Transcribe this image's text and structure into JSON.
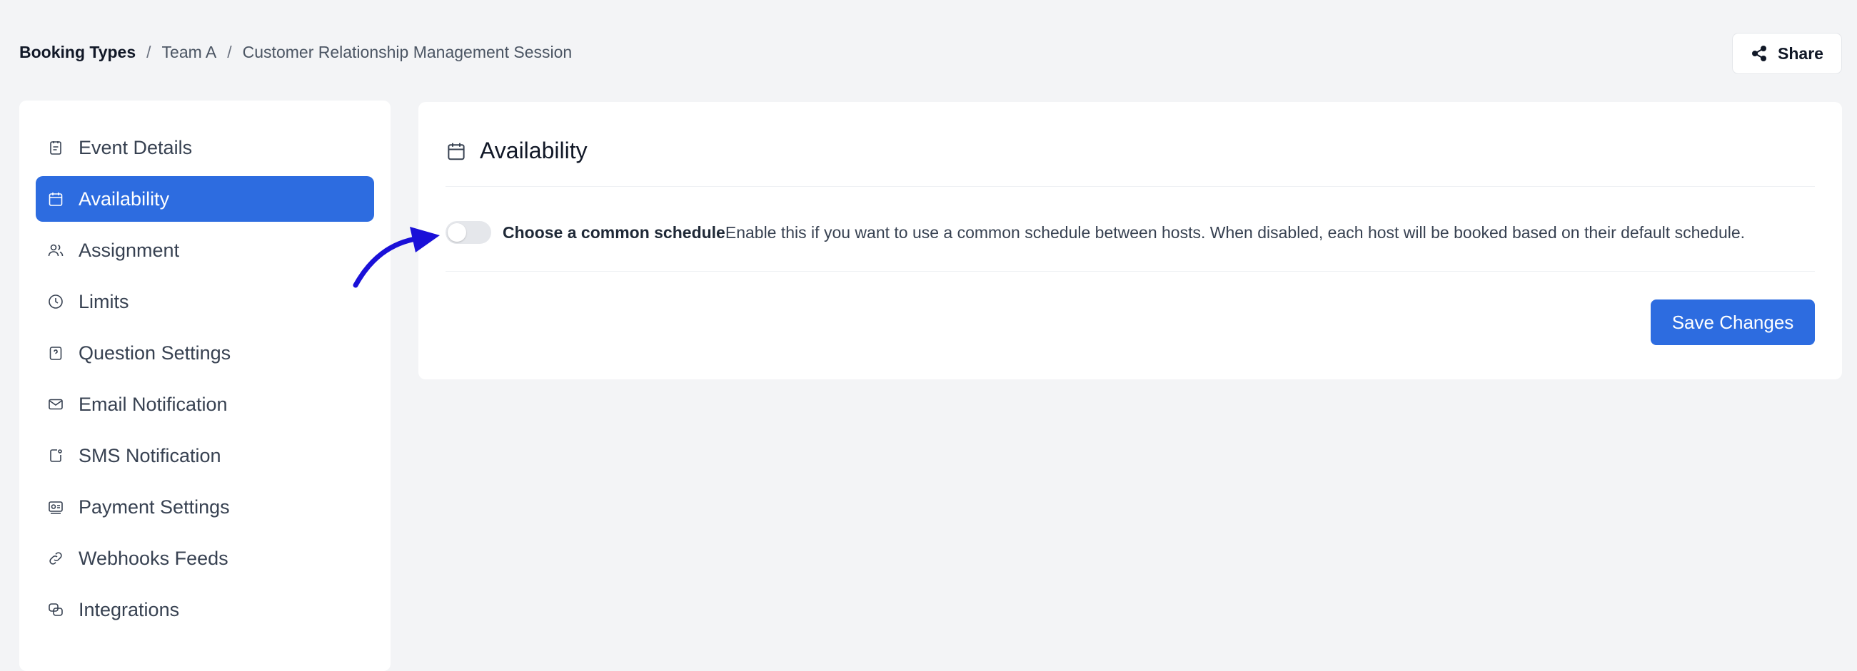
{
  "breadcrumb": {
    "root": "Booking Types",
    "team": "Team A",
    "current": "Customer Relationship Management Session",
    "separator": "/"
  },
  "header": {
    "share_label": "Share",
    "share_icon": "share-icon"
  },
  "sidebar": {
    "items": [
      {
        "label": "Event Details",
        "icon": "document-icon"
      },
      {
        "label": "Availability",
        "icon": "calendar-icon",
        "active": true
      },
      {
        "label": "Assignment",
        "icon": "users-icon"
      },
      {
        "label": "Limits",
        "icon": "clock-icon"
      },
      {
        "label": "Question Settings",
        "icon": "question-icon"
      },
      {
        "label": "Email Notification",
        "icon": "mail-icon"
      },
      {
        "label": "SMS Notification",
        "icon": "message-icon"
      },
      {
        "label": "Payment Settings",
        "icon": "payment-icon"
      },
      {
        "label": "Webhooks Feeds",
        "icon": "link-icon"
      },
      {
        "label": "Integrations",
        "icon": "integrations-icon"
      }
    ]
  },
  "main": {
    "title": "Availability",
    "title_icon": "calendar-icon",
    "common_schedule": {
      "label": "Choose a common schedule",
      "description": "Enable this if you want to use a common schedule between hosts. When disabled, each host will be booked based on their default schedule.",
      "enabled": false
    },
    "save_label": "Save Changes"
  },
  "colors": {
    "accent": "#2d6ce0",
    "background": "#f3f4f6",
    "annotation_arrow": "#1a10d8"
  }
}
